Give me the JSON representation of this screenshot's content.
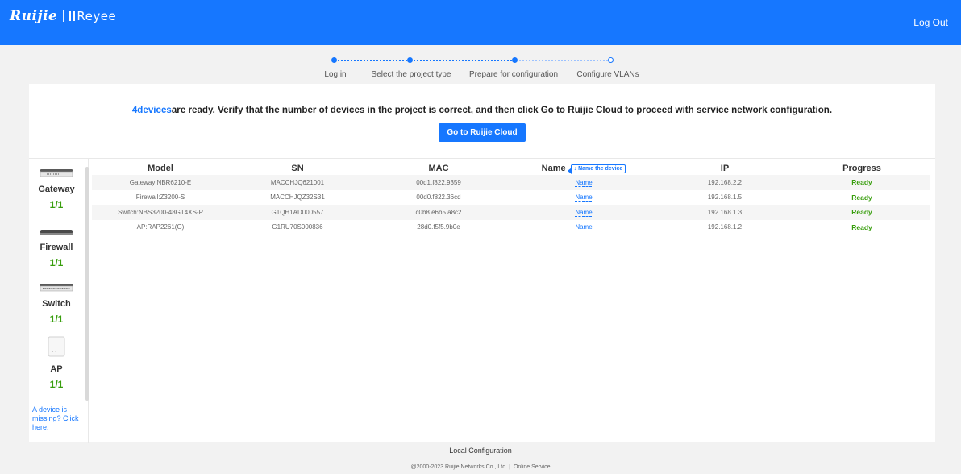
{
  "header": {
    "logo_primary": "Ruijie",
    "logo_secondary": "Reyee",
    "logout": "Log Out"
  },
  "steps": [
    {
      "label": "Log in",
      "state": "done"
    },
    {
      "label": "Select the project type",
      "state": "done"
    },
    {
      "label": "Prepare for configuration",
      "state": "done"
    },
    {
      "label": "Configure VLANs",
      "state": "todo"
    }
  ],
  "banner": {
    "count": "4devices",
    "message": "are ready. Verify that the number of devices in the project is correct, and then click Go to Ruijie Cloud to proceed with service network configuration.",
    "button": "Go to Ruijie Cloud"
  },
  "sidebar": {
    "devices": [
      {
        "name": "Gateway",
        "count": "1/1",
        "icon": "gateway-icon"
      },
      {
        "name": "Firewall",
        "count": "1/1",
        "icon": "firewall-icon"
      },
      {
        "name": "Switch",
        "count": "1/1",
        "icon": "switch-icon"
      },
      {
        "name": "AP",
        "count": "1/1",
        "icon": "ap-icon"
      }
    ],
    "missing_link": "A device is missing? Click here."
  },
  "table": {
    "columns": [
      "Model",
      "SN",
      "MAC",
      "Name",
      "IP",
      "Progress"
    ],
    "name_tip": "↓ Name the device",
    "rows": [
      {
        "model": "Gateway:NBR6210-E",
        "sn": "MACCHJQ621001",
        "mac": "00d1.f822.9359",
        "name": "Name",
        "ip": "192.168.2.2",
        "progress": "Ready"
      },
      {
        "model": "Firewall:Z3200-S",
        "sn": "MACCHJQZ32S31",
        "mac": "00d0.f822.36cd",
        "name": "Name",
        "ip": "192.168.1.5",
        "progress": "Ready"
      },
      {
        "model": "Switch:NBS3200-48GT4XS-P",
        "sn": "G1QH1AD000557",
        "mac": "c0b8.e6b5.a8c2",
        "name": "Name",
        "ip": "192.168.1.3",
        "progress": "Ready"
      },
      {
        "model": "AP:RAP2261(G)",
        "sn": "G1RU70S000836",
        "mac": "28d0.f5f5.9b0e",
        "name": "Name",
        "ip": "192.168.1.2",
        "progress": "Ready"
      }
    ]
  },
  "footer": {
    "local": "Local Configuration",
    "copyright": "@2000-2023 Ruijie Networks Co., Ltd",
    "online_service": "Online Service"
  },
  "colors": {
    "brand": "#1677ff",
    "ready": "#389e0d"
  }
}
